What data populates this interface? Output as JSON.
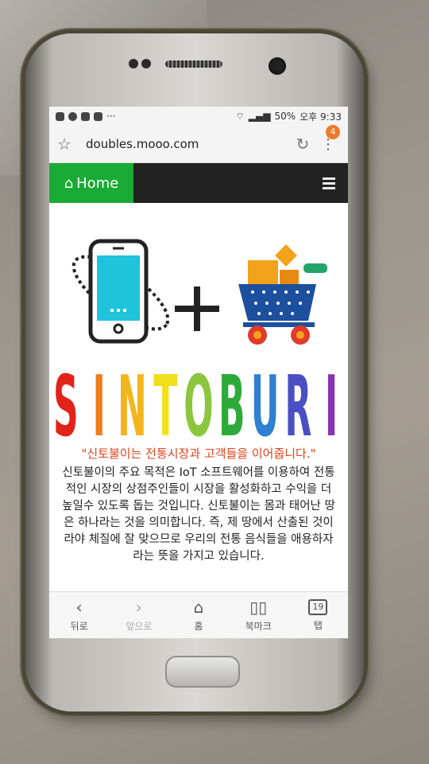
{
  "status": {
    "battery": "50%",
    "time": "오후 9:33",
    "dots": "···"
  },
  "browser": {
    "url": "doubles.mooo.com",
    "notification_count": "4"
  },
  "nav": {
    "home_label": "Home"
  },
  "brand": {
    "letters": [
      "S",
      "I",
      "N",
      "T",
      "O",
      "B",
      "U",
      "R",
      "I"
    ],
    "letter_colors": [
      "#e2231a",
      "#f07c1a",
      "#f3b51c",
      "#f2df1c",
      "#8cc63f",
      "#2eaa3a",
      "#2f80d1",
      "#4a4fc4",
      "#8a33b5"
    ]
  },
  "content": {
    "tagline": "\"신토불이는 전통시장과 고객들을 이어줍니다.\"",
    "description": "신토불이의 주요 목적은 IoT 소프트웨어를 이용하여 전통적인 시장의 상점주인들이 시장을 활성화하고 수익을 더 높일수 있도록 돕는 것입니다. 신토불이는 몸과 태어난 땅은 하나라는 것을 의미합니다. 즉, 제 땅에서 산출된 것이라야 체질에 잘 맞으므로 우리의 전통 음식들을 애용하자라는 뜻을 가지고 있습니다."
  },
  "bottom_bar": {
    "back": "뒤로",
    "forward": "앞으로",
    "home": "홈",
    "bookmarks": "북마크",
    "tabs": "탭",
    "tab_count": "19"
  }
}
